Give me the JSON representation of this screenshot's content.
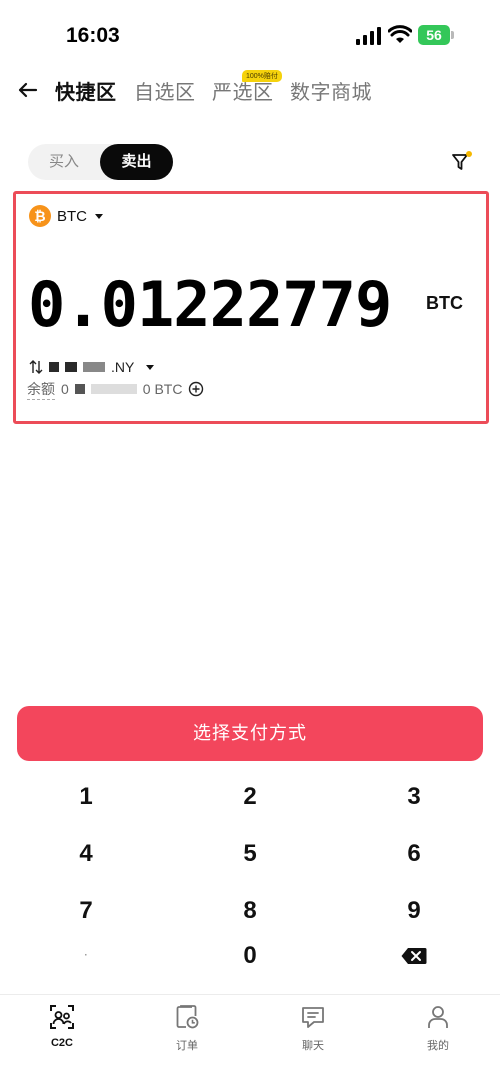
{
  "status_bar": {
    "time": "16:03",
    "battery": "56"
  },
  "nav": {
    "tabs": [
      {
        "label": "快捷区",
        "active": true
      },
      {
        "label": "自选区",
        "active": false
      },
      {
        "label": "严选区",
        "active": false,
        "badge": "100%赔付"
      },
      {
        "label": "数字商城",
        "active": false
      }
    ]
  },
  "trade_switch": {
    "buy_label": "买入",
    "sell_label": "卖出",
    "selected": "卖出"
  },
  "panel": {
    "coin": "BTC",
    "amount": "0.01222779",
    "amount_unit": "BTC",
    "fiat_currency_suffix": ".NY",
    "balance_label": "余额",
    "balance_prefix": "0",
    "balance_suffix": "0 BTC"
  },
  "pay_button": {
    "label": "选择支付方式"
  },
  "keypad": {
    "keys": [
      "1",
      "2",
      "3",
      "4",
      "5",
      "6",
      "7",
      "8",
      "9",
      "·",
      "0"
    ]
  },
  "tabbar": {
    "items": [
      {
        "label": "C2C",
        "active": true
      },
      {
        "label": "订单",
        "active": false
      },
      {
        "label": "聊天",
        "active": false
      },
      {
        "label": "我的",
        "active": false
      }
    ]
  },
  "colors": {
    "accent": "#f3465c",
    "highlight_border": "#ec4c58",
    "btc": "#f7931a",
    "badge": "#f5d20c"
  }
}
